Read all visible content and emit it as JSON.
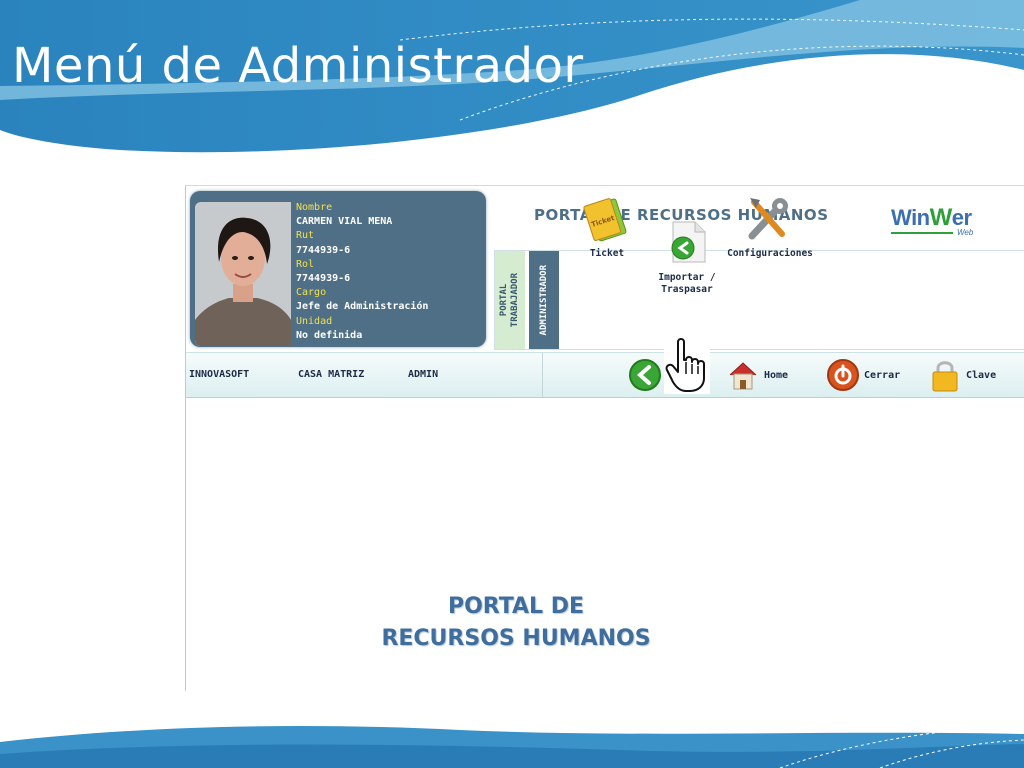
{
  "slide": {
    "title": "Menú de Administrador",
    "colors": {
      "banner": "#2b86c0",
      "banner_light": "#7fbfe0"
    }
  },
  "portal": {
    "title": "Portal de Recursos Humanos",
    "logo": {
      "text_a": "Win",
      "text_w": "W",
      "text_b": "er",
      "sub": "Web"
    },
    "profile": {
      "photo_icon": "employee-photo",
      "fields": [
        {
          "label": "Nombre",
          "value": "CARMEN VIAL MENA"
        },
        {
          "label": "Rut",
          "value": "7744939-6"
        },
        {
          "label": "Rol",
          "value": "7744939-6"
        },
        {
          "label": "Cargo",
          "value": "Jefe de Administración"
        },
        {
          "label": "Unidad",
          "value": "No definida"
        }
      ]
    },
    "tabs": {
      "trabajador": "PORTAL\nTRABAJADOR",
      "administrador": "ADMINISTRADOR"
    },
    "menu": [
      {
        "label": "Ticket",
        "icon": "ticket-icon"
      },
      {
        "label": "Importar /\nTraspasar",
        "icon": "import-icon"
      },
      {
        "label": "Configuraciones",
        "icon": "tools-icon"
      }
    ],
    "nav": [
      "INNOVASOFT",
      "CASA MATRIZ",
      "ADMIN"
    ],
    "toolbar": {
      "back_icon": "back-arrow-icon",
      "home": "Home",
      "close": "Cerrar",
      "key": "Clave"
    },
    "watermark": {
      "line1": "PORTAL DE",
      "line2": "RECURSOS HUMANOS"
    }
  }
}
